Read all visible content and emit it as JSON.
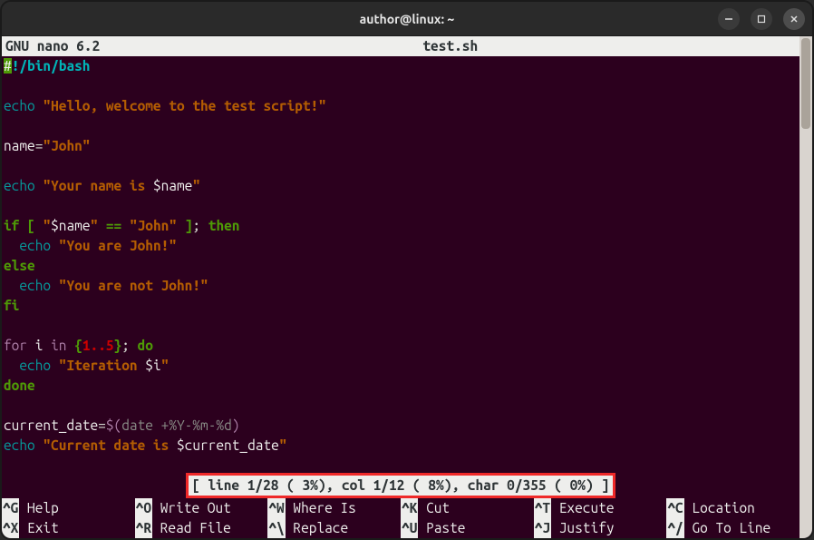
{
  "window": {
    "title": "author@linux: ~"
  },
  "nano": {
    "app": "  GNU nano 6.2",
    "filename": "test.sh"
  },
  "code": {
    "l1_a": "#",
    "l1_b": "!/bin/bash",
    "l3_a": "echo ",
    "l3_b": "\"Hello, welcome to the test script!\"",
    "l5_a": "name",
    "l5_b": "=",
    "l5_c": "\"John\"",
    "l7_a": "echo ",
    "l7_b": "\"Your name is ",
    "l7_c": "$name",
    "l7_d": "\"",
    "l9_a": "if [ ",
    "l9_b": "\"",
    "l9_c": "$name",
    "l9_d": "\"",
    "l9_e": " == ",
    "l9_f": "\"John\"",
    "l9_g": " ]",
    "l9_h": "; ",
    "l9_i": "then",
    "l10_a": "  ",
    "l10_b": "echo ",
    "l10_c": "\"You are John!\"",
    "l11": "else",
    "l12_a": "  ",
    "l12_b": "echo ",
    "l12_c": "\"You are not John!\"",
    "l13": "fi",
    "l15_a": "for",
    "l15_b": " i ",
    "l15_c": "in ",
    "l15_d": "{",
    "l15_e": "1..5",
    "l15_f": "}",
    "l15_g": "; ",
    "l15_h": "do",
    "l16_a": "  ",
    "l16_b": "echo ",
    "l16_c": "\"Iteration ",
    "l16_d": "$i",
    "l16_e": "\"",
    "l17": "done",
    "l19_a": "current_date",
    "l19_b": "=",
    "l19_c": "$(",
    "l19_d": "date +%Y-%m-%d",
    "l19_e": ")",
    "l20_a": "echo ",
    "l20_b": "\"Current date is ",
    "l20_c": "$current_date",
    "l20_d": "\""
  },
  "status": "[ line  1/28 ( 3%), col  1/12 (  8%), char   0/355 ( 0%) ]",
  "shortcuts": {
    "row1": [
      {
        "key": "^G",
        "label": " Help"
      },
      {
        "key": "^O",
        "label": " Write Out"
      },
      {
        "key": "^W",
        "label": " Where Is"
      },
      {
        "key": "^K",
        "label": " Cut"
      },
      {
        "key": "^T",
        "label": " Execute"
      },
      {
        "key": "^C",
        "label": " Location"
      }
    ],
    "row2": [
      {
        "key": "^X",
        "label": " Exit"
      },
      {
        "key": "^R",
        "label": " Read File"
      },
      {
        "key": "^\\",
        "label": " Replace"
      },
      {
        "key": "^U",
        "label": " Paste"
      },
      {
        "key": "^J",
        "label": " Justify"
      },
      {
        "key": "^/",
        "label": " Go To Line"
      }
    ]
  }
}
